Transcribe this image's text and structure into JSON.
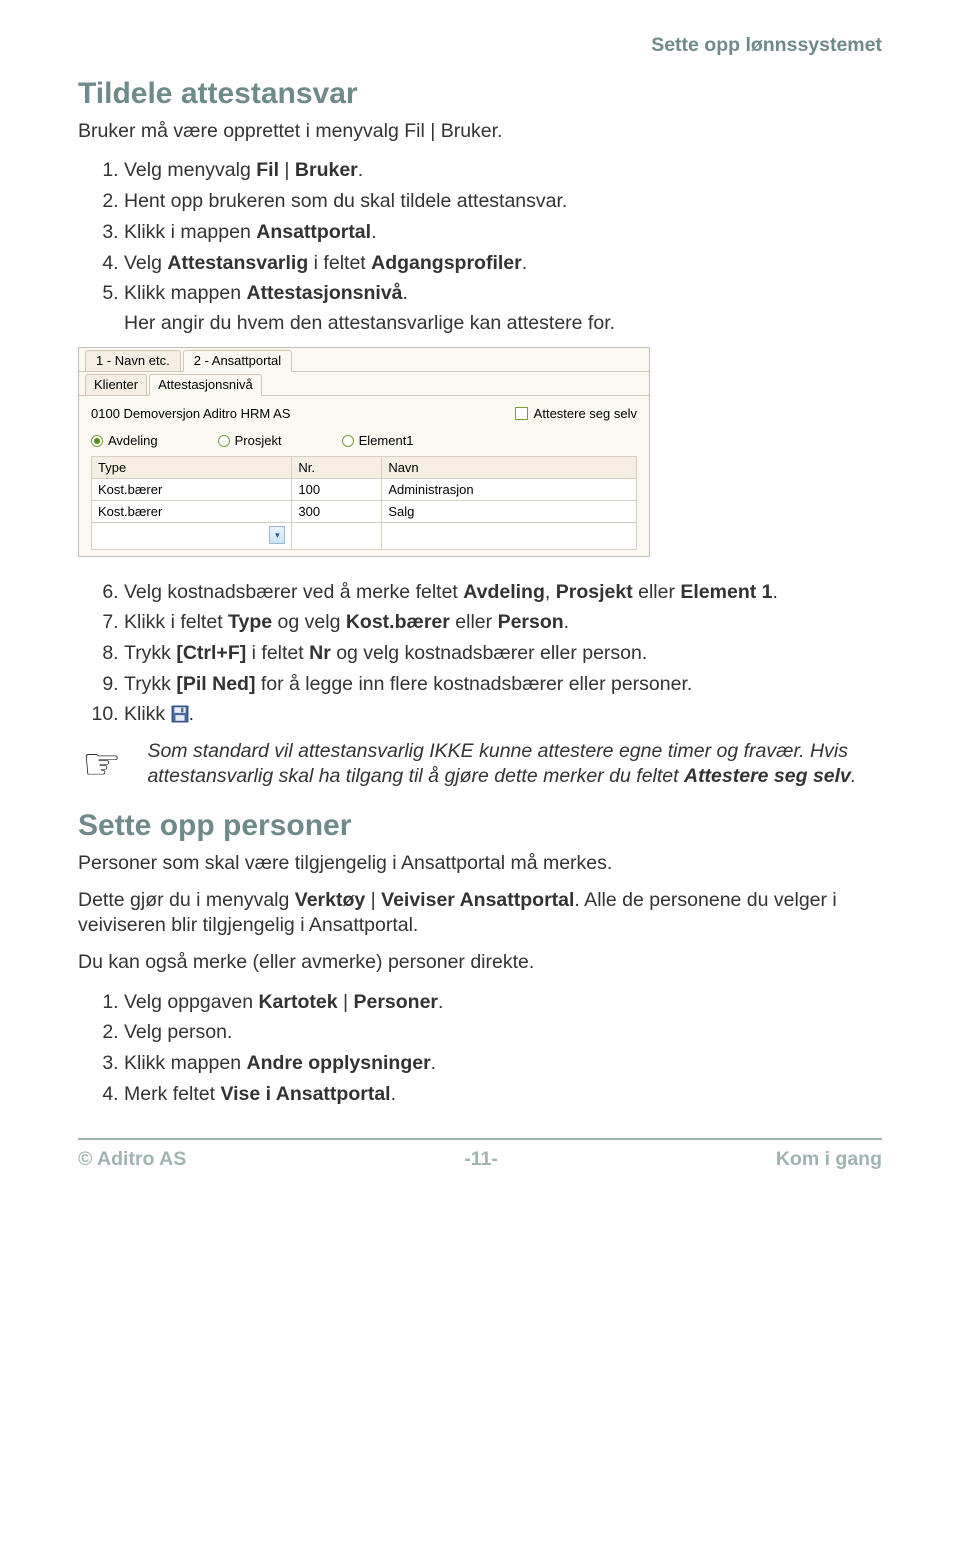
{
  "header": {
    "right": "Sette opp lønnssystemet"
  },
  "section1": {
    "title": "Tildele attestansvar",
    "lead": "Bruker må være opprettet i menyvalg Fil | Bruker.",
    "steps_a": [
      {
        "full": "Velg menyvalg <b>Fil</b> | <b>Bruker</b>."
      },
      {
        "full": "Hent opp brukeren som du skal tildele attestansvar."
      },
      {
        "full": "Klikk i mappen <b>Ansattportal</b>."
      },
      {
        "full": "Velg <b>Attestansvarlig</b> i feltet <b>Adgangsprofiler</b>."
      },
      {
        "full": "Klikk mappen <b>Attestasjonsnivå</b>.",
        "sub": "Her angir du hvem den attestansvarlige kan attestere for."
      }
    ],
    "steps_b_start": 6,
    "steps_b": [
      {
        "full": "Velg kostnadsbærer ved å merke feltet <b>Avdeling</b>, <b>Prosjekt</b> eller <b>Element 1</b>."
      },
      {
        "full": "Klikk i feltet <b>Type</b> og velg <b>Kost.bærer</b> eller <b>Person</b>."
      },
      {
        "full": "Trykk <b>[Ctrl+F]</b> i feltet <b>Nr</b> og velg kostnadsbærer eller person."
      },
      {
        "full": "Trykk <b>[Pil Ned]</b> for å legge inn flere kostnadsbærer eller personer."
      },
      {
        "full_pre": "Klikk ",
        "full_post": "."
      }
    ],
    "note": "Som standard vil attestansvarlig IKKE kunne attestere egne timer og fravær. Hvis attestansvarlig skal ha tilgang til å gjøre dette merker du feltet <b>Attestere seg selv</b>."
  },
  "screenshot": {
    "tabs_top": [
      {
        "label": "1 - Navn etc."
      },
      {
        "label": "2 - Ansattportal",
        "active": true
      }
    ],
    "tabs_sub": [
      {
        "label": "Klienter"
      },
      {
        "label": "Attestasjonsnivå",
        "active": true
      }
    ],
    "company": "0100 Demoversjon Aditro HRM AS",
    "chk_label": "Attestere seg selv",
    "radios": [
      {
        "label": "Avdeling",
        "selected": true
      },
      {
        "label": "Prosjekt"
      },
      {
        "label": "Element1"
      }
    ],
    "cols": [
      "Type",
      "Nr.",
      "Navn"
    ],
    "rows": [
      {
        "type": "Kost.bærer",
        "nr": "100",
        "navn": "Administrasjon"
      },
      {
        "type": "Kost.bærer",
        "nr": "300",
        "navn": "Salg"
      }
    ]
  },
  "section2": {
    "title": "Sette opp personer",
    "p1": "Personer som skal være tilgjengelig i Ansattportal må merkes.",
    "p2": "Dette gjør du i menyvalg <b>Verktøy</b> | <b>Veiviser Ansattportal</b>. Alle de personene du velger i veiviseren blir tilgjengelig i Ansattportal.",
    "p3": "Du kan også merke (eller avmerke) personer direkte.",
    "steps": [
      {
        "full": "Velg oppgaven <b>Kartotek</b> | <b>Personer</b>."
      },
      {
        "full": "Velg person."
      },
      {
        "full": "Klikk mappen <b>Andre opplysninger</b>."
      },
      {
        "full": "Merk feltet <b>Vise i Ansattportal</b>."
      }
    ]
  },
  "footer": {
    "left": "© Aditro AS",
    "center": "-11-",
    "right": "Kom i gang"
  }
}
